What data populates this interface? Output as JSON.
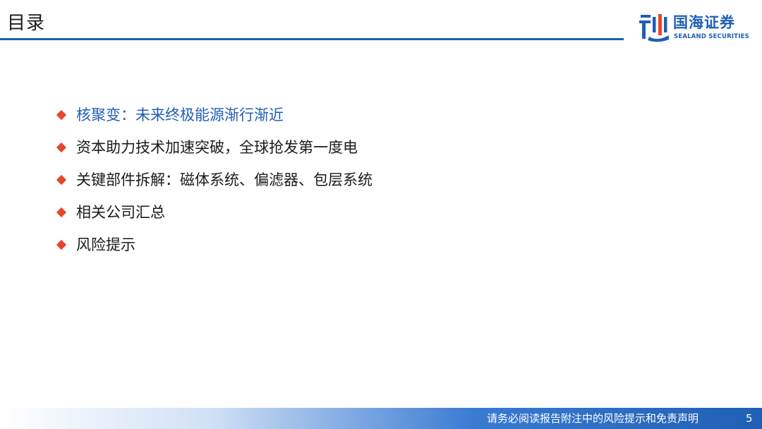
{
  "header": {
    "title": "目录"
  },
  "logo": {
    "name_cn": "国海证券",
    "name_en": "SEALAND SECURITIES"
  },
  "toc": {
    "items": [
      {
        "label": "核聚变：未来终极能源渐行渐近",
        "active": true
      },
      {
        "label": "资本助力技术加速突破，全球抢发第一度电",
        "active": false
      },
      {
        "label": "关键部件拆解：磁体系统、偏滤器、包层系统",
        "active": false
      },
      {
        "label": "相关公司汇总",
        "active": false
      },
      {
        "label": "风险提示",
        "active": false
      }
    ]
  },
  "footer": {
    "disclaimer": "请务必阅读报告附注中的风险提示和免责声明",
    "page_number": "5"
  },
  "colors": {
    "brand_blue": "#1f5fb4",
    "bullet_red": "#e8452c",
    "text_dark": "#1a1a1a"
  },
  "icons": {
    "bullet": "diamond-bullet-icon",
    "logo": "sealand-logo-icon"
  }
}
